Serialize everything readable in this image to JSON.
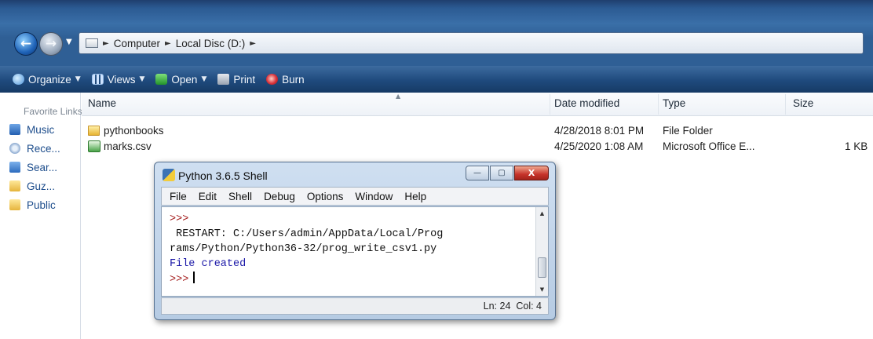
{
  "explorer": {
    "address": {
      "segments": [
        "Computer",
        "Local Disc (D:)"
      ]
    },
    "toolbar": {
      "organize": "Organize",
      "views": "Views",
      "open": "Open",
      "print": "Print",
      "burn": "Burn"
    },
    "sidebar": {
      "title": "Favorite Links",
      "items": [
        {
          "label": "Music",
          "icon": "music-icon"
        },
        {
          "label": "Rece...",
          "icon": "recent-icon"
        },
        {
          "label": "Sear...",
          "icon": "search-folder-icon"
        },
        {
          "label": "Guz...",
          "icon": "folder-icon"
        },
        {
          "label": "Public",
          "icon": "folder-icon"
        }
      ]
    },
    "columns": {
      "name": "Name",
      "date": "Date modified",
      "type": "Type",
      "size": "Size"
    },
    "files": [
      {
        "name": "pythonbooks",
        "date": "4/28/2018 8:01 PM",
        "type": "File Folder",
        "size": "",
        "icon": "folder-icon"
      },
      {
        "name": "marks.csv",
        "date": "4/25/2020 1:08 AM",
        "type": "Microsoft Office E...",
        "size": "1 KB",
        "icon": "excel-file-icon"
      }
    ]
  },
  "shell": {
    "title": "Python 3.6.5 Shell",
    "buttons": {
      "minimize": "—",
      "maximize": "▢",
      "close": "X"
    },
    "menu": [
      "File",
      "Edit",
      "Shell",
      "Debug",
      "Options",
      "Window",
      "Help"
    ],
    "lines": {
      "prompt1": ">>>",
      "restart1": " RESTART: C:/Users/admin/AppData/Local/Prog",
      "restart2": "rams/Python/Python36-32/prog_write_csv1.py",
      "result": "File created",
      "prompt2": ">>>"
    },
    "status": "Ln: 24  Col: 4"
  }
}
